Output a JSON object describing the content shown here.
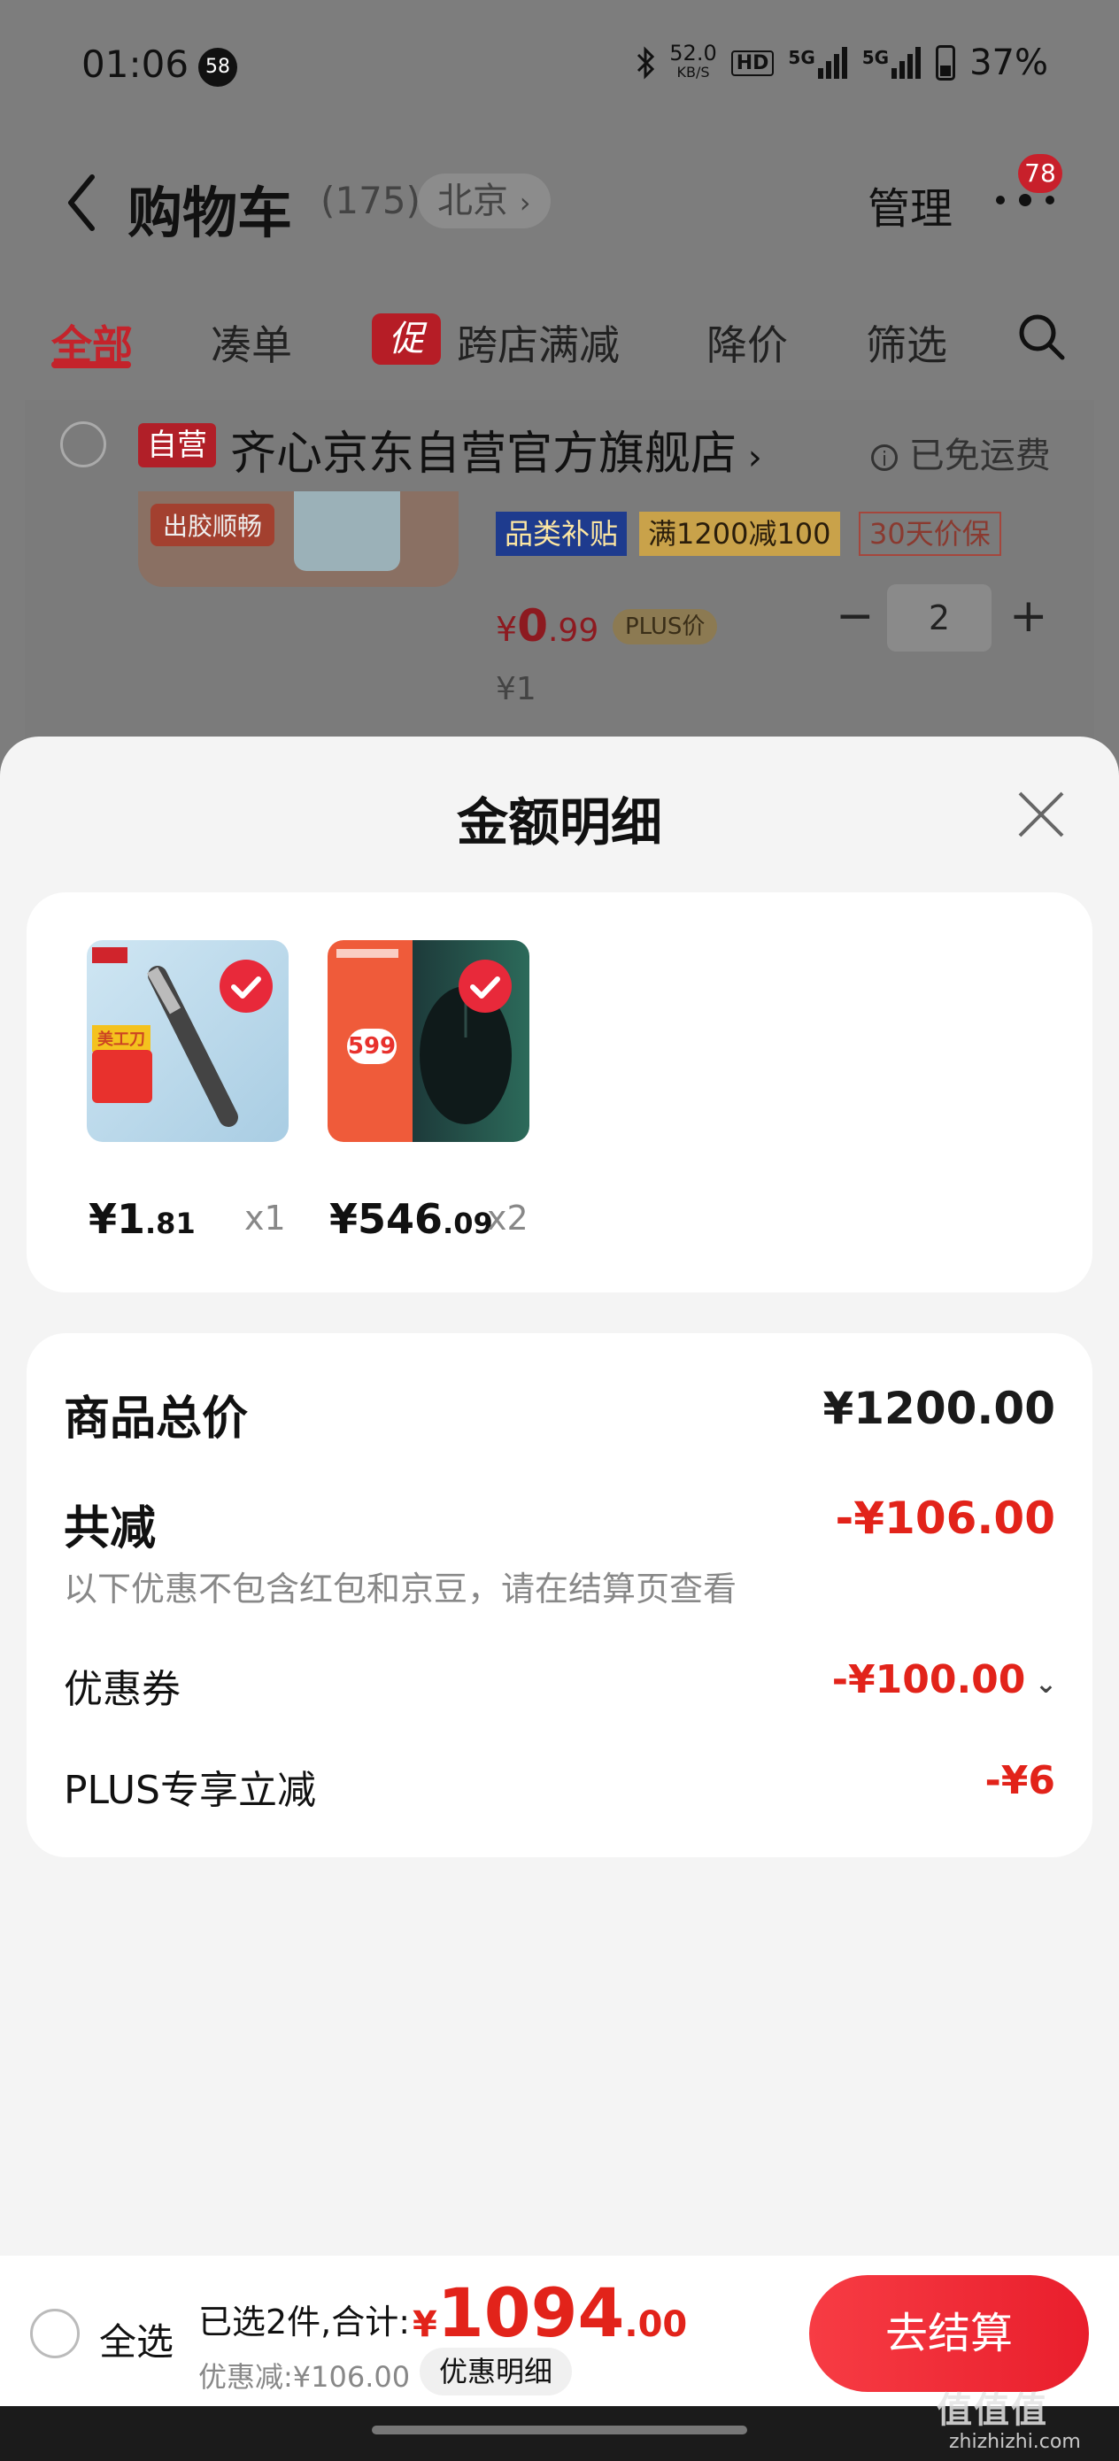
{
  "status_bar": {
    "time": "01:06",
    "notification_count": "58",
    "net_speed_value": "52.0",
    "net_speed_unit": "KB/S",
    "hd": "HD",
    "sim1": "5G",
    "sim2": "5G",
    "battery": "37%"
  },
  "header": {
    "title": "购物车",
    "count": "(175)",
    "city": "北京",
    "manage": "管理",
    "badge": "78"
  },
  "tabs": [
    {
      "label": "全部"
    },
    {
      "label": "凑单"
    },
    {
      "label": "跨店满减"
    },
    {
      "label": "降价"
    },
    {
      "label": "筛选"
    }
  ],
  "promo_chip": "促",
  "cart_store": {
    "self_tag": "自营",
    "name": "齐心京东自营官方旗舰店",
    "shipping": "已免运费"
  },
  "cart_item": {
    "tag_category": "品类补贴",
    "tag_discount": "满1200减100",
    "tag_price_protect": "30天价保",
    "price_symbol": "¥",
    "price_int": "0",
    "price_dec": ".99",
    "plus_label": "PLUS价",
    "qty": "2",
    "qty_minus": "−",
    "qty_plus": "+",
    "orig_price": "¥1",
    "img_text": "出胶顺畅"
  },
  "sheet": {
    "title": "金额明细"
  },
  "products": [
    {
      "price_int": "¥1",
      "price_dec": ".81",
      "qty": "x1",
      "img_label": "美工刀"
    },
    {
      "price_int": "¥546",
      "price_dec": ".09",
      "qty": "x2",
      "img_label": "599"
    }
  ],
  "summary": {
    "total_label": "商品总价",
    "total_value": "¥1200.00",
    "reduce_label": "共减",
    "reduce_value": "-¥106.00",
    "note": "以下优惠不包含红包和京豆，请在结算页查看",
    "coupon_label": "优惠券",
    "coupon_value": "-¥100.00",
    "plus_label": "PLUS专享立减",
    "plus_value": "-¥6"
  },
  "bottom_bar": {
    "select_all": "全选",
    "selected_summary": "已选2件,合计:",
    "total_symbol": "¥",
    "total_int": "1094",
    "total_dec": ".00",
    "discount": "优惠减:¥106.00",
    "detail_button": "优惠明细",
    "checkout": "去结算"
  },
  "watermark": {
    "text": "值值值",
    "url": "zhizhizhi.com"
  },
  "colors": {
    "accent_red": "#e2231a",
    "tab_red": "#c4232b",
    "checkout_red": "#f0303a"
  }
}
